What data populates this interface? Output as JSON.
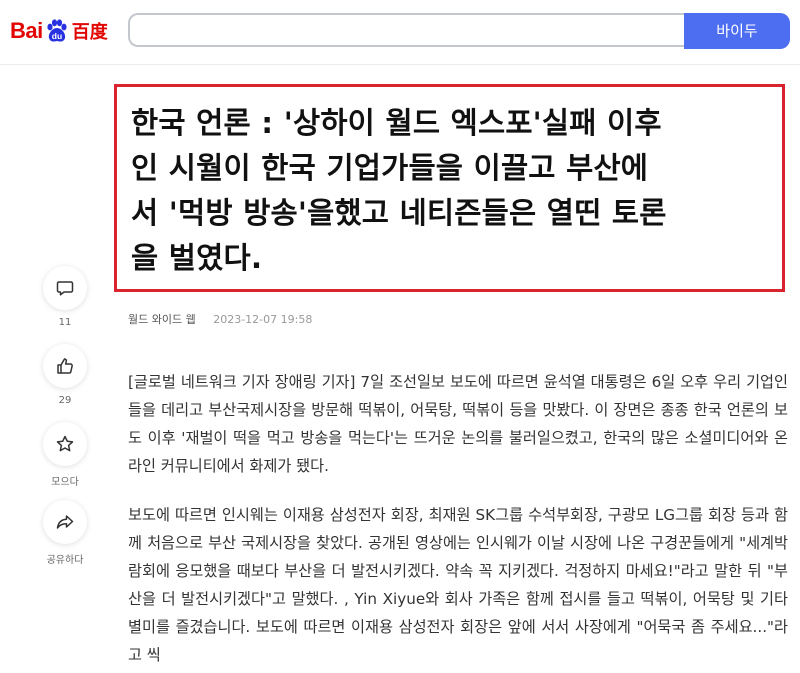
{
  "header": {
    "logo_bai": "Bai",
    "logo_du": "du",
    "logo_cn": "百度",
    "search_value": "",
    "search_button": "바이두"
  },
  "article": {
    "title": "한국 언론 : '상하이 월드 엑스포'실패 이후 인 시월이 한국 기업가들을 이끌고 부산에서 '먹방 방송'을했고 네티즌들은 열띤 토론을 벌였다.",
    "title_lines": [
      "한국 언론 : '상하이 월드 엑스포'실패 이후",
      "인 시월이 한국 기업가들을 이끌고 부산에",
      "서 '먹방 방송'을했고 네티즌들은 열띤 토론",
      "을 벌였다."
    ],
    "source": "월드 와이드 웹",
    "date": "2023-12-07 19:58",
    "paragraphs": [
      "[글로벌 네트워크 기자 장애링 기자] 7일 조선일보 보도에 따르면 윤석열 대통령은 6일 오후 우리 기업인들을 데리고 부산국제시장을 방문해 떡볶이, 어묵탕, 떡볶이 등을 맛봤다. 이 장면은 종종 한국 언론의 보도 이후 '재벌이 떡을 먹고 방송을 먹는다'는 뜨거운 논의를 불러일으켰고, 한국의 많은 소셜미디어와 온라인 커뮤니티에서 화제가 됐다.",
      "보도에 따르면 인시웨는 이재용 삼성전자 회장, 최재원 SK그룹 수석부회장, 구광모 LG그룹 회장 등과 함께 처음으로 부산 국제시장을 찾았다. 공개된 영상에는 인시웨가 이날 시장에 나온 구경꾼들에게 \"세계박람회에 응모했을 때보다 부산을 더 발전시키겠다. 약속 꼭 지키겠다. 걱정하지 마세요!\"라고 말한 뒤 \"부산을 더 발전시키겠다\"고 말했다. , Yin Xiyue와 회사 가족은 함께 접시를 들고 떡볶이, 어묵탕 및 기타 별미를 즐겼습니다. 보도에 따르면 이재용 삼성전자 회장은 앞에 서서 사장에게 \"어묵국 좀 주세요...\"라고 씩"
    ]
  },
  "actions": {
    "comment": {
      "icon": "comment-icon",
      "count": "11"
    },
    "like": {
      "icon": "thumbs-up-icon",
      "count": "29"
    },
    "collect": {
      "icon": "star-icon",
      "label": "모으다"
    },
    "share": {
      "icon": "share-icon",
      "label": "공유하다"
    }
  },
  "colors": {
    "brand_red": "#e10602",
    "brand_blue": "#2932e1",
    "search_button": "#4e6ef2",
    "title_border": "#d9232e"
  }
}
